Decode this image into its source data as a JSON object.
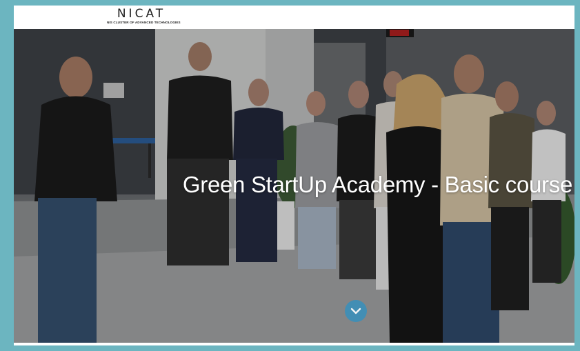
{
  "header": {
    "logo_text": "NICAT",
    "logo_subtitle": "NIS CLUSTER OF ADVANCED TECHNOLOGIES"
  },
  "hero": {
    "title": "Green StartUp Academy - Basic course",
    "scroll_icon": "chevron-down-icon",
    "scroll_button_color": "#3d8fb8"
  },
  "colors": {
    "page_border": "#6cb5c0",
    "header_bg": "#ffffff",
    "title_text": "#ffffff"
  }
}
